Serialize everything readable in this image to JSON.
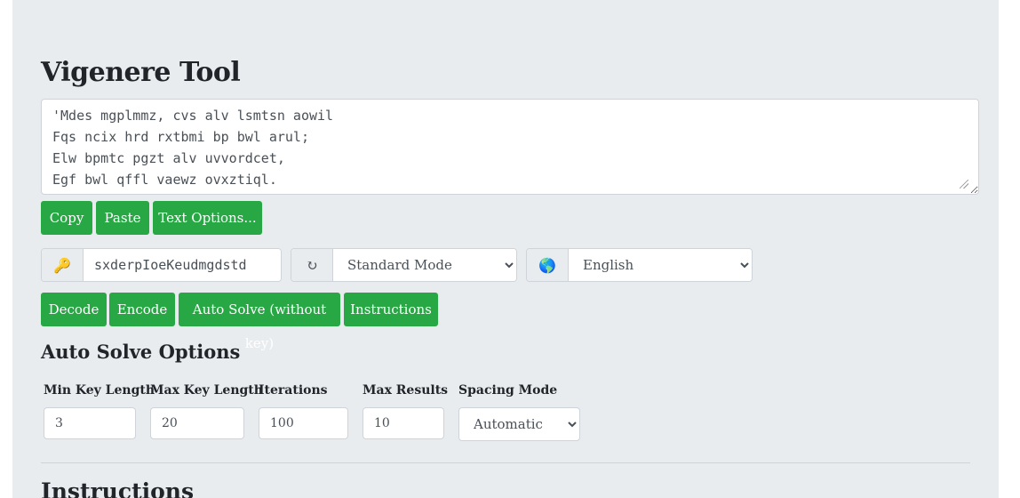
{
  "title": "Vigenere Tool",
  "ciphertext": "'Mdes mgplmmz, cvs alv lsmtsn aowil\nFqs ncix hrd rxtbmi bp bwl arul;\nElw bpmtc pgzt alv uvvordcet,\nEgf bwl qffl vaewz ovxztiql.",
  "text_buttons": {
    "copy": "Copy",
    "paste": "Paste",
    "text_options": "Text Options..."
  },
  "key": {
    "icon": "key-icon",
    "icon_glyph": "🔑",
    "value": "sxderpIoeKeudmgdstd"
  },
  "mode": {
    "icon": "refresh-icon",
    "icon_glyph": "↻",
    "selected": "Standard Mode"
  },
  "language": {
    "icon": "globe-icon",
    "icon_glyph": "🌎",
    "selected": "English"
  },
  "action_buttons": {
    "decode": "Decode",
    "encode": "Encode",
    "auto_solve": "Auto Solve (without key)",
    "instructions": "Instructions"
  },
  "auto_solve": {
    "heading": "Auto Solve Options",
    "min_key_length": {
      "label": "Min Key Length",
      "value": "3"
    },
    "max_key_length": {
      "label": "Max Key Length",
      "value": "20"
    },
    "iterations": {
      "label": "Iterations",
      "value": "100"
    },
    "max_results": {
      "label": "Max Results",
      "value": "10"
    },
    "spacing_mode": {
      "label": "Spacing Mode",
      "selected": "Automatic"
    }
  },
  "instructions_heading": "Instructions",
  "colors": {
    "accent": "#28a745",
    "panel_bg": "#e9ecef",
    "border": "#ced4da"
  }
}
